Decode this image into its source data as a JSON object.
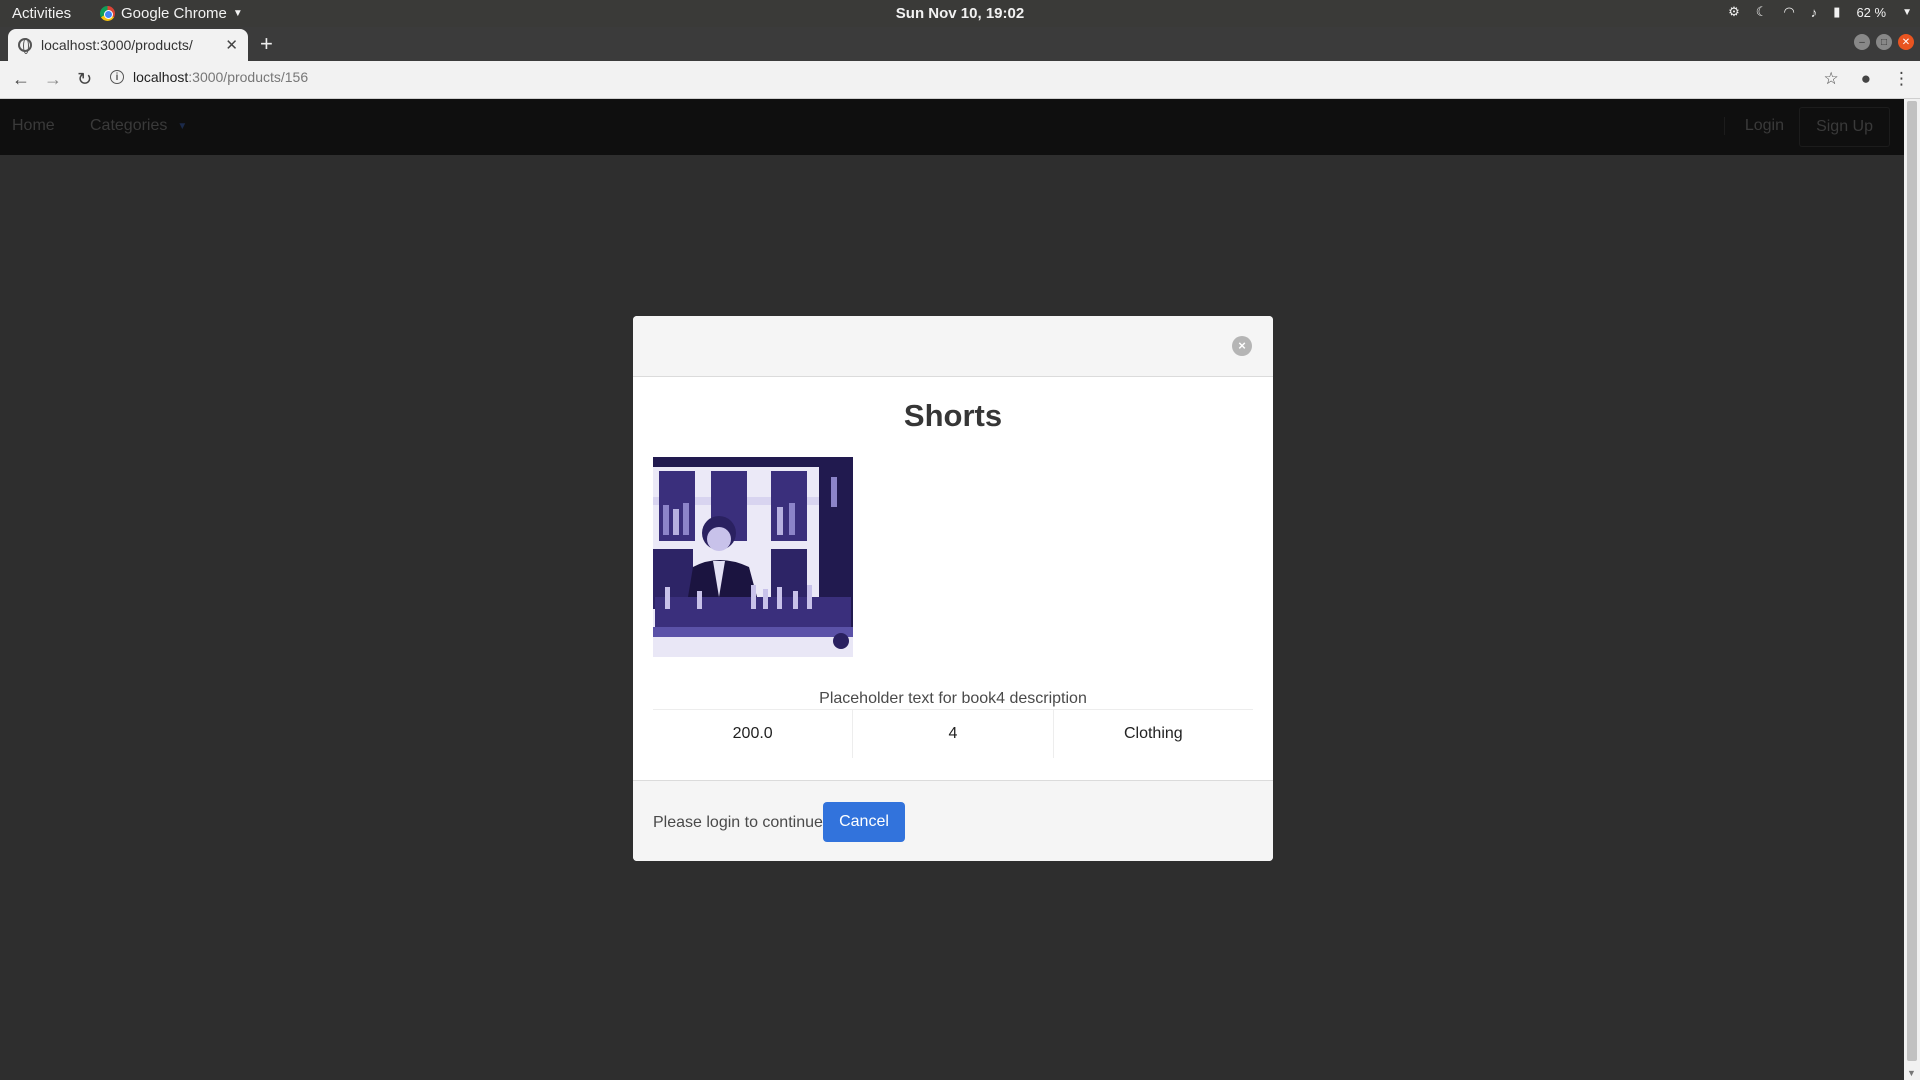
{
  "os_bar": {
    "activities": "Activities",
    "app_name": "Google Chrome",
    "clock": "Sun Nov 10, 19:02",
    "battery": "62 %"
  },
  "browser": {
    "tab_title": "localhost:3000/products/",
    "url_host": "localhost",
    "url_path": ":3000/products/156"
  },
  "navbar": {
    "home": "Home",
    "categories": "Categories",
    "login": "Login",
    "signup": "Sign Up"
  },
  "modal": {
    "title": "Shorts",
    "image_alt": "Product photo of a bartender behind a bar with shelves of bottles",
    "description": "Placeholder text for book4 description",
    "price": "200.0",
    "quantity": "4",
    "category": "Clothing",
    "footer_text": "Please login to continue",
    "cancel_label": "Cancel"
  },
  "colors": {
    "overlay": "#2e2e2e",
    "primary_button": "#3273dc",
    "image_tint": "#4b3f8f"
  }
}
